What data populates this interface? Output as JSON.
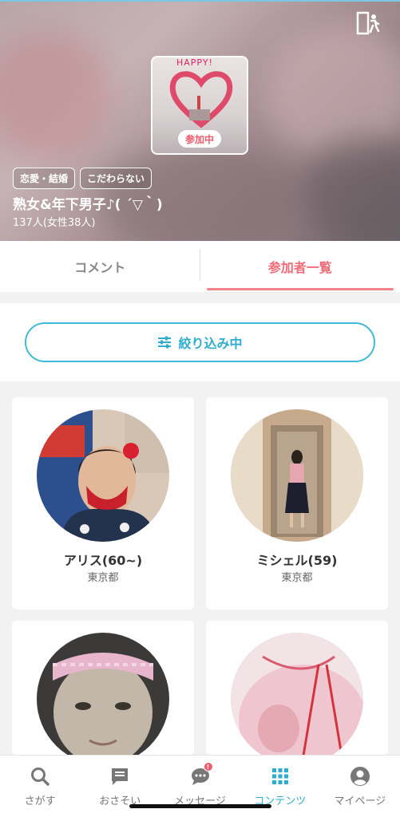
{
  "header": {
    "joined_badge": "参加中",
    "tags": [
      "恋愛・結婚",
      "こだわらない"
    ],
    "title": "熟女&年下男子♪( ´▽｀)",
    "member_count": "137人(女性38人)",
    "thumbnail_text": "HAPPY!"
  },
  "tabs": [
    {
      "label": "コメント",
      "active": false
    },
    {
      "label": "参加者一覧",
      "active": true
    }
  ],
  "filter": {
    "label": "絞り込み中"
  },
  "members": [
    {
      "name": "アリス(60~)",
      "location": "東京都"
    },
    {
      "name": "ミシェル(59)",
      "location": "東京都"
    },
    {
      "name": "",
      "location": ""
    },
    {
      "name": "",
      "location": ""
    }
  ],
  "bottom_nav": [
    {
      "label": "さがす",
      "icon": "search-icon",
      "active": false
    },
    {
      "label": "おさそい",
      "icon": "invite-icon",
      "active": false
    },
    {
      "label": "メッセージ",
      "icon": "chat-icon",
      "active": false,
      "badge": "!"
    },
    {
      "label": "コンテンツ",
      "icon": "grid-icon",
      "active": true
    },
    {
      "label": "マイページ",
      "icon": "user-icon",
      "active": false
    }
  ],
  "colors": {
    "accent_blue": "#2daed0",
    "accent_pink": "#f06a78"
  }
}
